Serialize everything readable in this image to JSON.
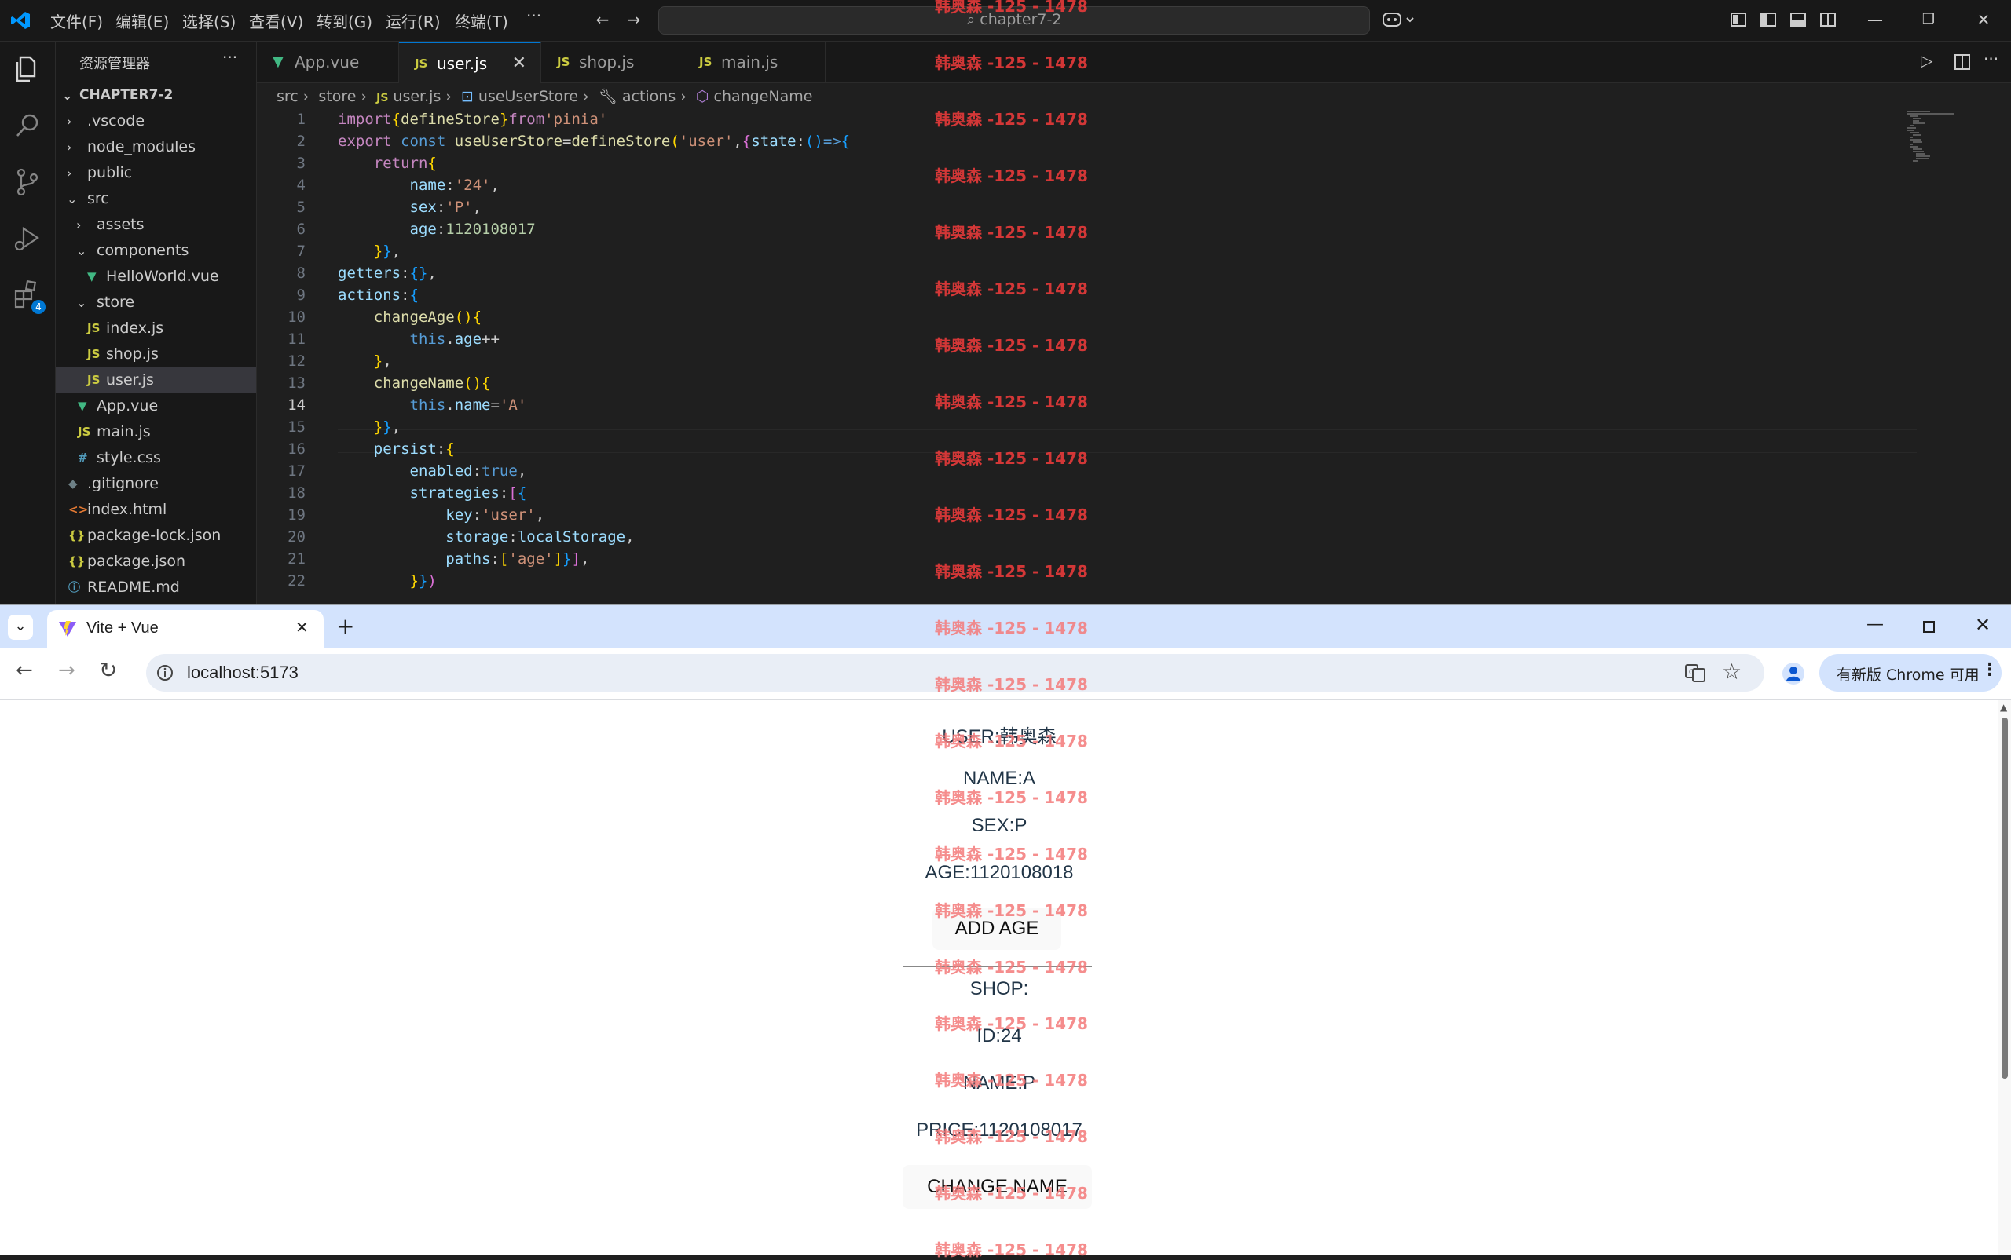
{
  "vscode": {
    "menu": [
      "文件(F)",
      "编辑(E)",
      "选择(S)",
      "查看(V)",
      "转到(G)",
      "运行(R)",
      "终端(T)",
      "···"
    ],
    "search_placeholder": "chapter7-2",
    "extensions_badge": "4",
    "explorer": {
      "title": "资源管理器",
      "more": "···",
      "root": "CHAPTER7-2",
      "items": [
        {
          "label": ".vscode",
          "kind": "folder",
          "open": false
        },
        {
          "label": "node_modules",
          "kind": "folder",
          "open": false
        },
        {
          "label": "public",
          "kind": "folder",
          "open": false
        },
        {
          "label": "src",
          "kind": "folder",
          "open": true
        },
        {
          "label": "assets",
          "kind": "folder",
          "open": false
        },
        {
          "label": "components",
          "kind": "folder",
          "open": true
        },
        {
          "label": "HelloWorld.vue",
          "kind": "vue"
        },
        {
          "label": "store",
          "kind": "folder",
          "open": true
        },
        {
          "label": "index.js",
          "kind": "js"
        },
        {
          "label": "shop.js",
          "kind": "js"
        },
        {
          "label": "user.js",
          "kind": "js",
          "selected": true
        },
        {
          "label": "App.vue",
          "kind": "vue"
        },
        {
          "label": "main.js",
          "kind": "js"
        },
        {
          "label": "style.css",
          "kind": "css"
        },
        {
          "label": ".gitignore",
          "kind": "git"
        },
        {
          "label": "index.html",
          "kind": "html"
        },
        {
          "label": "package-lock.json",
          "kind": "json"
        },
        {
          "label": "package.json",
          "kind": "json"
        },
        {
          "label": "README.md",
          "kind": "info"
        }
      ]
    },
    "tabs": [
      {
        "label": "App.vue",
        "kind": "vue"
      },
      {
        "label": "user.js",
        "kind": "js",
        "active": true
      },
      {
        "label": "shop.js",
        "kind": "js"
      },
      {
        "label": "main.js",
        "kind": "js"
      }
    ],
    "breadcrumb": [
      "src",
      "store",
      "user.js",
      "useUserStore",
      "actions",
      "changeName"
    ],
    "file_icon_js": "JS",
    "close_glyph": "✕",
    "current_line": 14,
    "line_numbers": [
      "1",
      "2",
      "3",
      "4",
      "5",
      "6",
      "7",
      "8",
      "9",
      "10",
      "11",
      "12",
      "13",
      "14",
      "15",
      "16",
      "17",
      "18",
      "19",
      "20",
      "21",
      "22"
    ]
  },
  "chrome": {
    "tab_title": "Vite + Vue",
    "new_tab": "+",
    "url": "localhost:5173",
    "update_label": "有新版 Chrome 可用",
    "page": {
      "user": "USER:韩奥森",
      "name": "NAME:A",
      "sex": "SEX:P",
      "age": "AGE:1120108018",
      "add_age_button": "ADD AGE",
      "shop": "SHOP:",
      "id": "ID:24",
      "shop_name": "NAME:P",
      "price": "PRICE:1120108017",
      "change_name_button": "CHANGE NAME"
    }
  },
  "watermark": "韩奥森 -125 - 1478"
}
